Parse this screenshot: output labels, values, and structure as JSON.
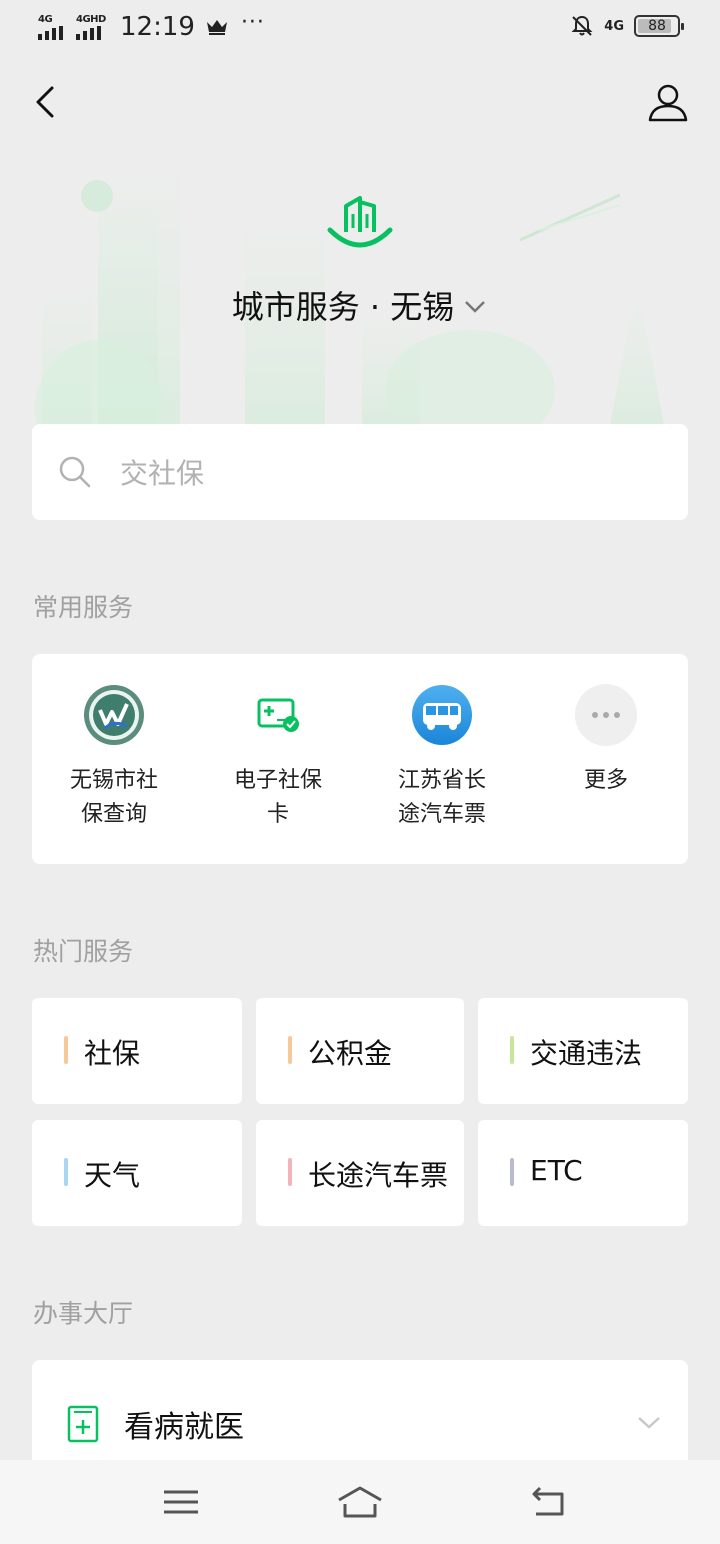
{
  "status_bar": {
    "signal1": "4G",
    "signal2": "4GHD",
    "time": "12:19",
    "dots": "···",
    "network": "4G",
    "battery": "88",
    "battery_level": 0.88
  },
  "header": {
    "title": "城市服务 · 无锡"
  },
  "search": {
    "placeholder": "交社保"
  },
  "common_services": {
    "title": "常用服务",
    "items": [
      {
        "label_line1": "无锡市社",
        "label_line2": "保查询",
        "icon": "wuxi-social-security-logo"
      },
      {
        "label_line1": "电子社保",
        "label_line2": "卡",
        "icon": "e-social-card-icon"
      },
      {
        "label_line1": "江苏省长",
        "label_line2": "途汽车票",
        "icon": "bus-icon"
      },
      {
        "label_line1": "更多",
        "label_line2": "",
        "icon": "more-icon"
      }
    ]
  },
  "hot_services": {
    "title": "热门服务",
    "items": [
      {
        "label": "社保",
        "color": "#f5c99a"
      },
      {
        "label": "公积金",
        "color": "#f5c99a"
      },
      {
        "label": "交通违法",
        "color": "#c8e59a"
      },
      {
        "label": "天气",
        "color": "#a9d6f2"
      },
      {
        "label": "长途汽车票",
        "color": "#f4b3b8"
      },
      {
        "label": "ETC",
        "color": "#b8bccc"
      }
    ]
  },
  "hall": {
    "title": "办事大厅",
    "items": [
      {
        "label": "看病就医",
        "icon": "medical-card-icon"
      }
    ]
  },
  "colors": {
    "brand_green": "#07c160",
    "background": "#ededed"
  }
}
